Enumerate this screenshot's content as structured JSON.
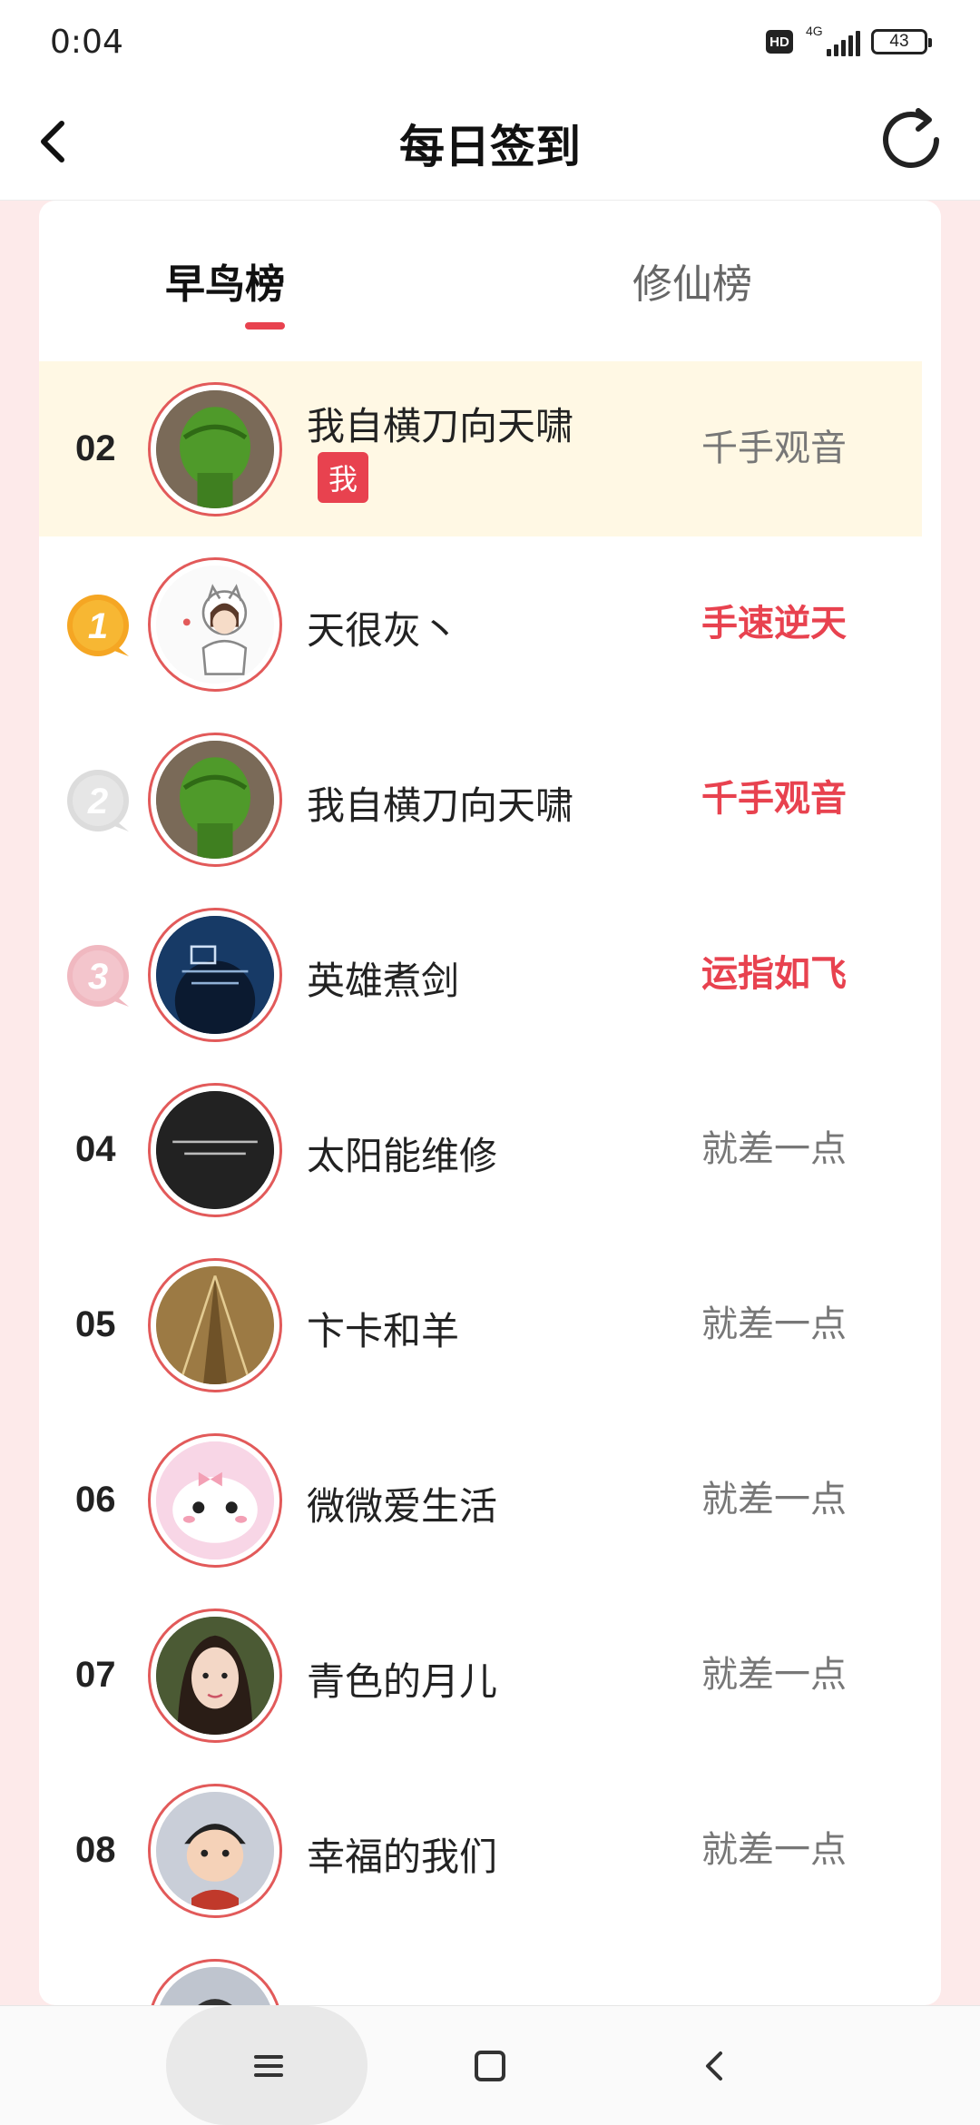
{
  "status_bar": {
    "time": "0:04",
    "hd": "HD",
    "network": "4G",
    "battery": "43"
  },
  "header": {
    "title": "每日签到",
    "back_icon": "back-arrow-icon",
    "refresh_icon": "refresh-icon"
  },
  "tabs": [
    {
      "label": "早鸟榜",
      "active": true
    },
    {
      "label": "修仙榜",
      "active": false
    }
  ],
  "me_badge": "我",
  "list": [
    {
      "rank": "02",
      "name": "我自横刀向天啸",
      "title": "千手观音",
      "is_me": true
    },
    {
      "rank": "1",
      "name": "天很灰丶",
      "title": "手速逆天",
      "medal": "gold"
    },
    {
      "rank": "2",
      "name": "我自横刀向天啸",
      "title": "千手观音",
      "medal": "silver"
    },
    {
      "rank": "3",
      "name": "英雄煮剑",
      "title": "运指如飞",
      "medal": "bronze"
    },
    {
      "rank": "04",
      "name": "太阳能维修",
      "title": "就差一点"
    },
    {
      "rank": "05",
      "name": "卞卡和羊",
      "title": "就差一点"
    },
    {
      "rank": "06",
      "name": "微微爱生活",
      "title": "就差一点"
    },
    {
      "rank": "07",
      "name": "青色的月儿",
      "title": "就差一点"
    },
    {
      "rank": "08",
      "name": "幸福的我们",
      "title": "就差一点"
    }
  ],
  "colors": {
    "accent": "#e8424f",
    "me_row_bg": "#fff8e4",
    "page_bg": "#fdeaea",
    "gold": "#f5a623",
    "silver": "#d9d9d9",
    "bronze": "#f0b8c0"
  },
  "nav_bar": {
    "menu_icon": "menu-icon",
    "home_icon": "home-square-icon",
    "back_icon": "nav-back-icon"
  }
}
